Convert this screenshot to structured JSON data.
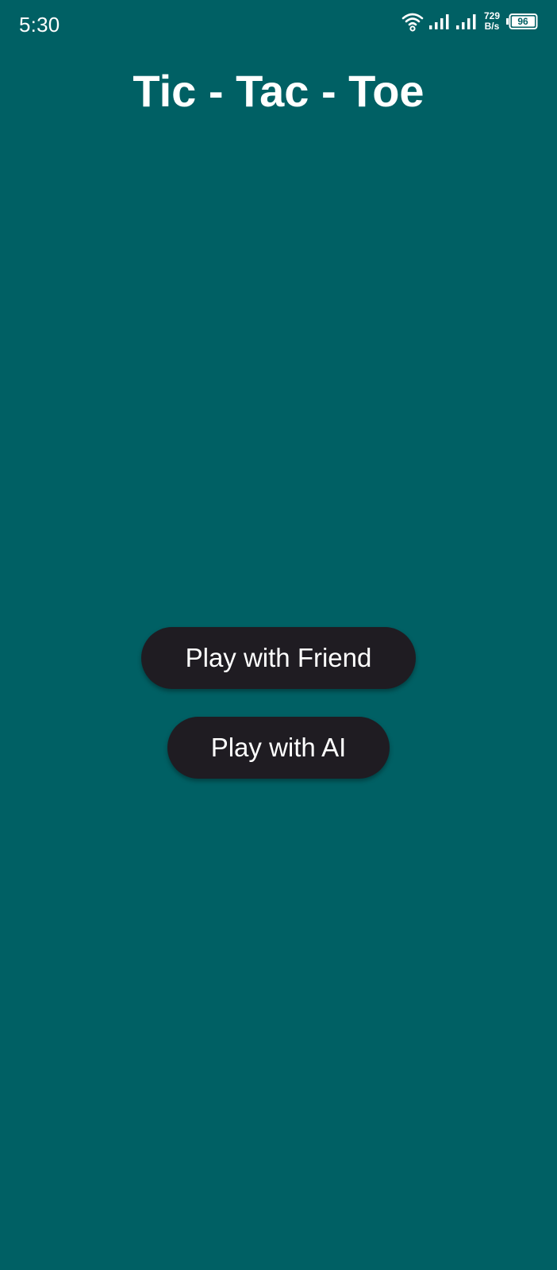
{
  "status_bar": {
    "time": "5:30",
    "net_speed_value": "729",
    "net_speed_unit": "B/s",
    "battery": "96",
    "icons": [
      "wifi-icon",
      "signal-icon",
      "signal-icon",
      "battery-icon"
    ]
  },
  "app": {
    "title": "Tic - Tac - Toe"
  },
  "menu": {
    "friend_label": "Play with Friend",
    "ai_label": "Play with AI"
  },
  "colors": {
    "background": "#006064",
    "button": "#1f1c22",
    "text": "#ffffff"
  }
}
